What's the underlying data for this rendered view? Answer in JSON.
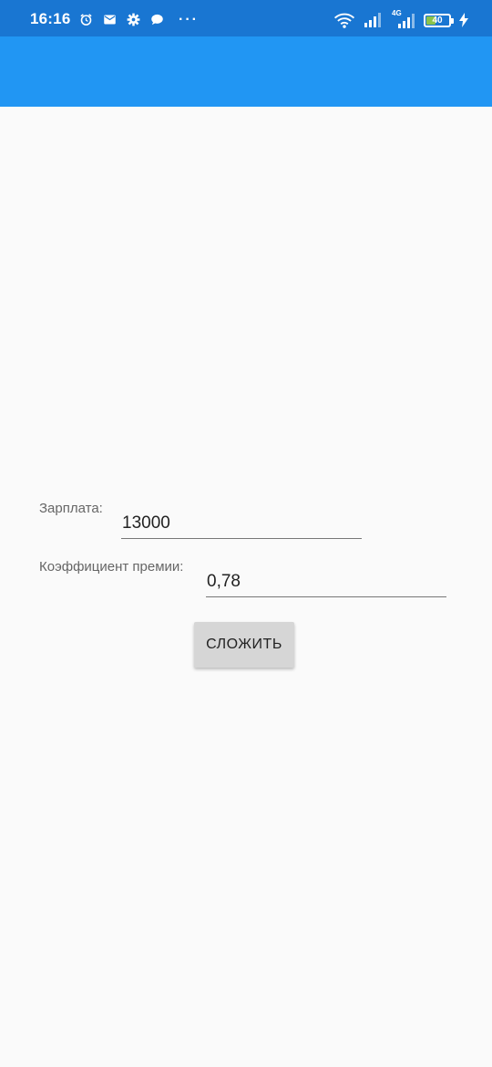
{
  "status_bar": {
    "time": "16:16",
    "battery_level": "40",
    "battery_fraction": 0.4,
    "icons_left": [
      "alarm-icon",
      "mail-icon",
      "settings-icon",
      "chat-icon",
      "more-dots-icon"
    ],
    "more_dots": "···",
    "network_label": "4G",
    "icons_right": [
      "wifi-icon",
      "signal-icon",
      "signal-4g-icon",
      "battery-icon",
      "charging-icon"
    ]
  },
  "colors": {
    "status_bar": "#1976d2",
    "app_bar": "#2196f3",
    "background": "#fafafa",
    "button": "#d6d6d6"
  },
  "form": {
    "salary_label": "Зарплата:",
    "salary_value": "13000",
    "bonus_label": "Коэффициент премии:",
    "bonus_value": "0,78",
    "add_button_label": "СЛОЖИТЬ"
  }
}
